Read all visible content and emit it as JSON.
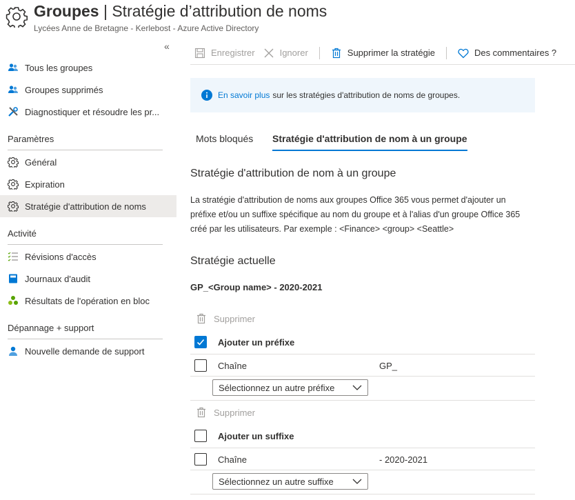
{
  "header": {
    "title_bold": "Groupes",
    "title_sep": " | ",
    "title_rest": "Stratégie d’attribution de noms",
    "subtitle": "Lycées Anne de Bretagne - Kerlebost - Azure Active Directory"
  },
  "sidebar": {
    "collapse": "«",
    "items_top": [
      {
        "label": "Tous les groupes",
        "icon": "users-icon"
      },
      {
        "label": "Groupes supprimés",
        "icon": "users-icon"
      },
      {
        "label": "Diagnostiquer et résoudre les pr...",
        "icon": "wrench-icon"
      }
    ],
    "section_parametres": "Paramètres",
    "items_parametres": [
      {
        "label": "Général",
        "icon": "gear-icon"
      },
      {
        "label": "Expiration",
        "icon": "gear-icon"
      },
      {
        "label": "Stratégie d'attribution de noms",
        "icon": "gear-icon",
        "active": true
      }
    ],
    "section_activite": "Activité",
    "items_activite": [
      {
        "label": "Révisions d'accès",
        "icon": "list-check-icon"
      },
      {
        "label": "Journaux d'audit",
        "icon": "book-icon"
      },
      {
        "label": "Résultats de l'opération en bloc",
        "icon": "tree-icon"
      }
    ],
    "section_support": "Dépannage + support",
    "items_support": [
      {
        "label": "Nouvelle demande de support",
        "icon": "person-support-icon"
      }
    ]
  },
  "toolbar": {
    "save": "Enregistrer",
    "ignore": "Ignorer",
    "delete_policy": "Supprimer la stratégie",
    "feedback": "Des commentaires ?"
  },
  "info": {
    "link": "En savoir plus",
    "text": "sur les stratégies d'attribution de noms de groupes."
  },
  "tabs": {
    "blocked": "Mots bloqués",
    "policy": "Stratégie d'attribution de nom à un groupe"
  },
  "main": {
    "heading": "Stratégie d'attribution de nom à un groupe",
    "description": "La stratégie d'attribution de noms aux groupes Office 365 vous permet d'ajouter un préfixe et/ou un suffixe spécifique au nom du groupe et à l'alias d'un groupe Office 365 créé par les utilisateurs. Par exemple : <Finance> <group> <Seattle>",
    "current_heading": "Stratégie actuelle",
    "current_policy": "GP_<Group name> - 2020-2021"
  },
  "prefix": {
    "delete": "Supprimer",
    "add_label": "Ajouter un préfixe",
    "add_checked": true,
    "string_label": "Chaîne",
    "string_value": "GP_",
    "select": "Sélectionnez un autre préfixe"
  },
  "suffix": {
    "delete": "Supprimer",
    "add_label": "Ajouter un suffixe",
    "add_checked": false,
    "string_label": "Chaîne",
    "string_value": "- 2020-2021",
    "select": "Sélectionnez un autre suffixe"
  },
  "colors": {
    "accent": "#0078d4",
    "info_bg": "#eff6fc",
    "active_nav": "#edebe9"
  }
}
